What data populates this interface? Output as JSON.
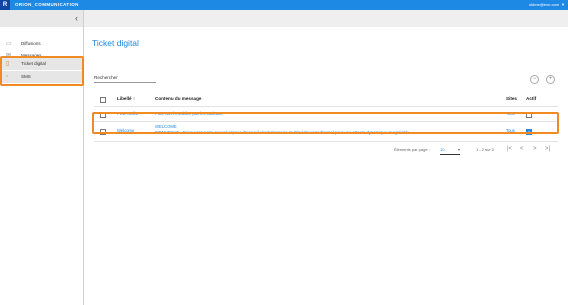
{
  "header": {
    "logo_letter": "R",
    "app_name": "ORION_COMMUNICATION",
    "user": "oldme@ecn.com",
    "user_caret": "▼"
  },
  "sidebar": {
    "collapse_glyph": "‹",
    "items": [
      {
        "label": "Diffusions",
        "icon": "monitor-icon"
      },
      {
        "label": "Messages",
        "icon": "chat-icon"
      },
      {
        "label": "Ticket digital",
        "icon": "phone-icon"
      },
      {
        "label": "SMS",
        "icon": "sms-icon"
      }
    ]
  },
  "main": {
    "title": "Ticket digital",
    "search_placeholder": "Rechercher",
    "remove_glyph": "−",
    "add_glyph": "+",
    "columns": {
      "libelle": "Libellé ↑",
      "contenu": "Contenu du message",
      "sites": "Sites",
      "actif": "Actif"
    },
    "rows": [
      {
        "libelle": "PUB NOËL",
        "contenu_1": "Pour Noël n'oubliez pas les cadeaux",
        "contenu_2": "",
        "sites": "Tous",
        "actif": false
      },
      {
        "libelle": "Welcome",
        "contenu_1": "WELCOME",
        "contenu_2": "BIENVENUE : Découvrez notre nouvel espace d'accueil révolutionnaire multimédia et multicanal pour une attente dynamique et agréable",
        "sites": "Tous",
        "actif": true
      }
    ],
    "pagination": {
      "per_page_label": "Éléments par page :",
      "per_page_value": "10",
      "range": "1 - 2 sur 2",
      "first": "|<",
      "prev": "<",
      "next": ">",
      "last": ">|"
    }
  },
  "colors": {
    "accent": "#1e88e5",
    "highlight": "#f08a24"
  }
}
